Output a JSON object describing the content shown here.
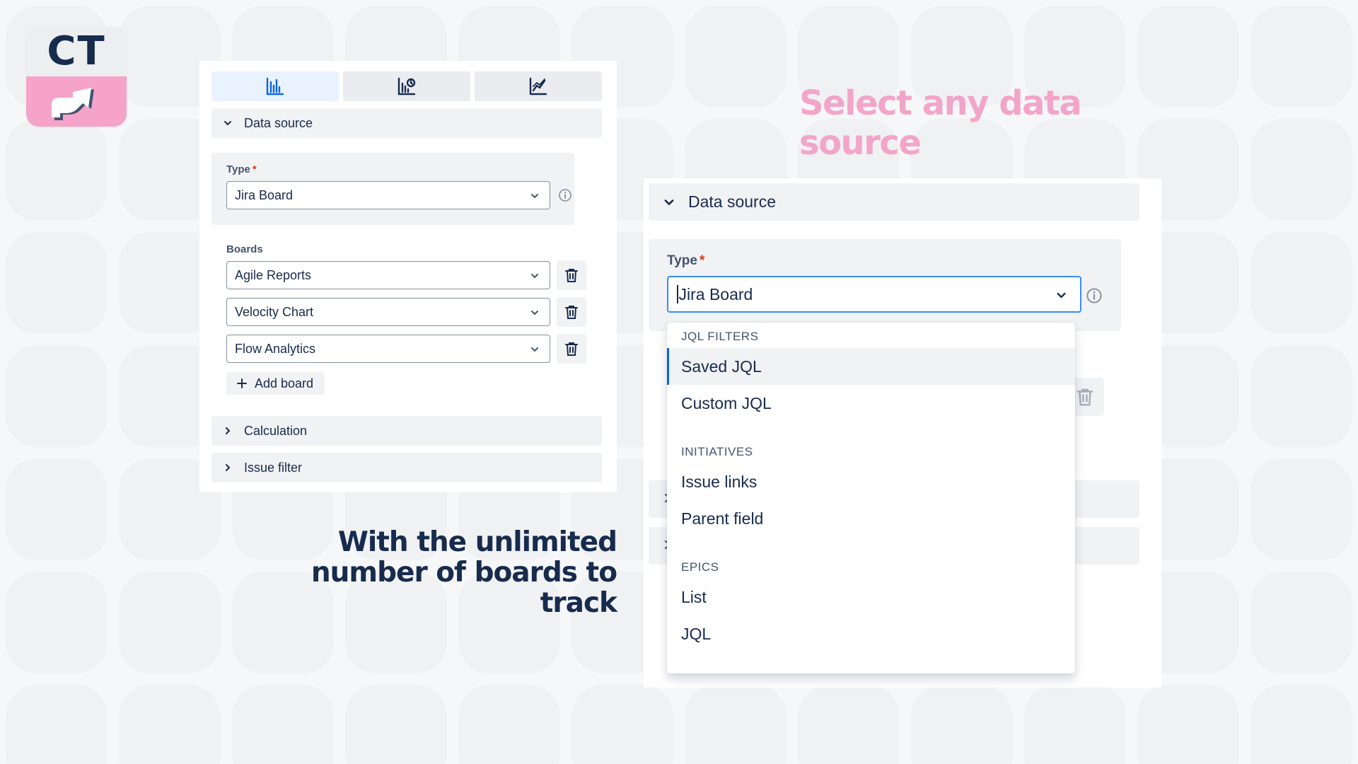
{
  "colors": {
    "headline_pink": "#f3a5c9",
    "headline_dark": "#172b4d",
    "accent_blue": "#0c66e4",
    "focus_border": "#388bff",
    "required": "#de350b",
    "logo_pink": "#f5a3c9"
  },
  "logo": {
    "text": "CT",
    "icon": "chart-arrow-logo-icon"
  },
  "headlines": {
    "top": "Select any data source",
    "bottom_line1": "With the unlimited",
    "bottom_line2": "number of boards to track"
  },
  "left_panel": {
    "tabs": [
      {
        "icon": "bar-chart-icon",
        "active": true
      },
      {
        "icon": "chart-clock-icon",
        "active": false
      },
      {
        "icon": "line-chart-icon",
        "active": false
      }
    ],
    "data_source": {
      "title": "Data source",
      "type_label": "Type",
      "required_mark": "*",
      "type_value": "Jira Board",
      "boards_label": "Boards",
      "boards": [
        "Agile Reports",
        "Velocity Chart",
        "Flow Analytics"
      ],
      "add_board_label": "Add board"
    },
    "calculation_title": "Calculation",
    "issue_filter_title": "Issue filter"
  },
  "right_panel": {
    "title": "Data source",
    "type_label": "Type",
    "required_mark": "*",
    "type_value": "Jira Board",
    "menu": {
      "groups": [
        {
          "label": "JQL FILTERS",
          "options": [
            "Saved JQL",
            "Custom JQL"
          ]
        },
        {
          "label": "INITIATIVES",
          "options": [
            "Issue links",
            "Parent field"
          ]
        },
        {
          "label": "EPICS",
          "options": [
            "List",
            "JQL"
          ]
        }
      ],
      "selected": "Saved JQL"
    }
  }
}
